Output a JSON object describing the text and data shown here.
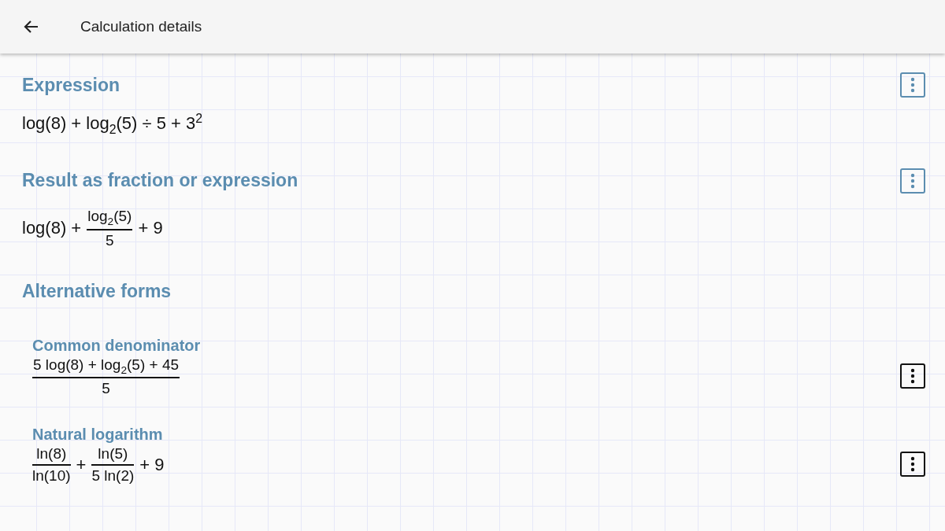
{
  "header": {
    "title": "Calculation details"
  },
  "sections": [
    {
      "title": "Expression",
      "terms": [
        {
          "kind": "text",
          "text": "log(8) + log$_{2}$(5) ÷ 5 + 3$^{2}$"
        }
      ]
    },
    {
      "title": "Result as fraction or expression",
      "terms": [
        {
          "kind": "text",
          "text": "log(8) +"
        },
        {
          "kind": "frac",
          "num": "log$_{2}$(5)",
          "den": "5"
        },
        {
          "kind": "text",
          "text": "+ 9"
        }
      ]
    },
    {
      "title": "Alternative forms",
      "forms": [
        {
          "title": "Common denominator",
          "terms": [
            {
              "kind": "frac",
              "num": "5 log(8) + log$_{2}$(5) + 45",
              "den": "5"
            }
          ]
        },
        {
          "title": "Natural logarithm",
          "terms": [
            {
              "kind": "frac",
              "num": "ln(8)",
              "den": "ln(10)"
            },
            {
              "kind": "text",
              "text": "+"
            },
            {
              "kind": "frac",
              "num": "ln(5)",
              "den": "5 ln(2)"
            },
            {
              "kind": "text",
              "text": "+ 9"
            }
          ]
        }
      ]
    }
  ]
}
